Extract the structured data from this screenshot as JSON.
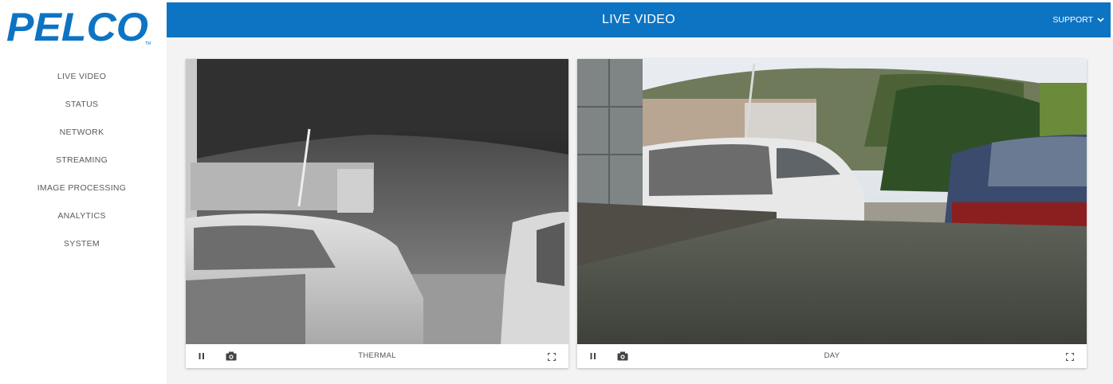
{
  "brand": {
    "logo_text": "PELCO",
    "trademark": "TM",
    "color": "#0d74c4"
  },
  "header": {
    "title": "LIVE VIDEO",
    "support_label": "SUPPORT",
    "support_icon": "chevron-down-icon"
  },
  "sidebar": {
    "items": [
      {
        "label": "LIVE VIDEO"
      },
      {
        "label": "STATUS"
      },
      {
        "label": "NETWORK"
      },
      {
        "label": "STREAMING"
      },
      {
        "label": "IMAGE PROCESSING"
      },
      {
        "label": "ANALYTICS"
      },
      {
        "label": "SYSTEM"
      }
    ]
  },
  "streams": [
    {
      "label": "THERMAL",
      "pause_icon": "pause-icon",
      "snapshot_icon": "camera-icon",
      "fullscreen_icon": "fullscreen-icon"
    },
    {
      "label": "DAY",
      "pause_icon": "pause-icon",
      "snapshot_icon": "camera-icon",
      "fullscreen_icon": "fullscreen-icon"
    }
  ]
}
